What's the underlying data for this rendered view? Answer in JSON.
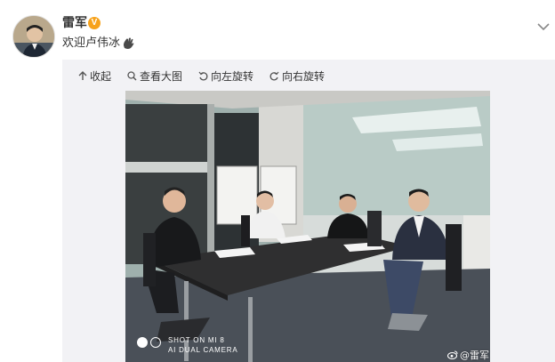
{
  "post": {
    "author": "雷军",
    "verified_badge": "V",
    "text": "欢迎卢伟冰",
    "emoji_icon": "wave-hand-icon"
  },
  "toolbar": {
    "collapse": "收起",
    "view_large": "查看大图",
    "rotate_left": "向左旋转",
    "rotate_right": "向右旋转"
  },
  "photo": {
    "camera_line1": "SHOT ON MI 8",
    "camera_line2": "AI DUAL CAMERA",
    "watermark": "@雷军"
  },
  "colors": {
    "badge": "#f7a21b",
    "panel_bg": "#f2f2f5"
  }
}
